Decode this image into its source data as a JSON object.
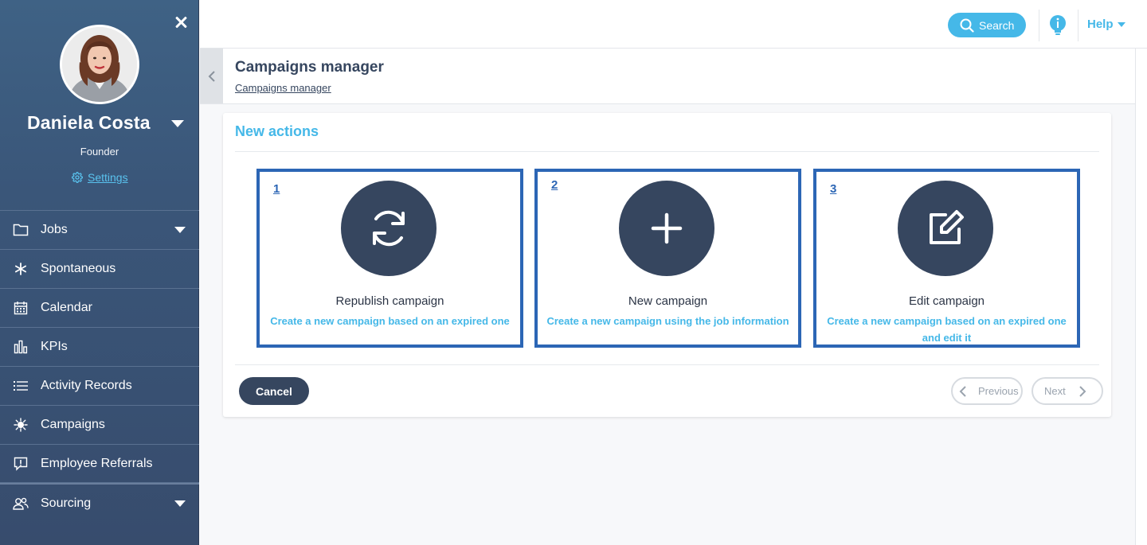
{
  "sidebar": {
    "user": {
      "name": "Daniela Costa",
      "role": "Founder",
      "settings_label": "Settings"
    },
    "items": [
      {
        "label": "Jobs",
        "icon": "folder-icon",
        "has_submenu": true
      },
      {
        "label": "Spontaneous",
        "icon": "asterisk-icon",
        "has_submenu": false
      },
      {
        "label": "Calendar",
        "icon": "calendar-icon",
        "has_submenu": false
      },
      {
        "label": "KPIs",
        "icon": "bar-chart-icon",
        "has_submenu": false
      },
      {
        "label": "Activity Records",
        "icon": "list-icon",
        "has_submenu": false
      },
      {
        "label": "Campaigns",
        "icon": "virus-icon",
        "has_submenu": false
      },
      {
        "label": "Employee Referrals",
        "icon": "feedback-icon",
        "has_submenu": false
      },
      {
        "label": "Sourcing",
        "icon": "users-icon",
        "has_submenu": true
      }
    ]
  },
  "topbar": {
    "search_label": "Search",
    "help_label": "Help"
  },
  "header": {
    "title": "Campaigns manager",
    "breadcrumb": "Campaigns manager"
  },
  "card": {
    "title": "New actions",
    "actions": [
      {
        "number": "1",
        "icon": "refresh-icon",
        "title": "Republish campaign",
        "description": "Create a new campaign based on an expired one"
      },
      {
        "number": "2",
        "icon": "plus-icon",
        "title": "New campaign",
        "description": "Create a new campaign using the job information"
      },
      {
        "number": "3",
        "icon": "edit-icon",
        "title": "Edit campaign",
        "description": "Create a new campaign based on an expired one and edit it"
      }
    ],
    "cancel_label": "Cancel",
    "previous_label": "Previous",
    "next_label": "Next"
  },
  "colors": {
    "accent": "#45b8e8",
    "sidebar": "#3a5679",
    "dark": "#36465f",
    "highlight_border": "#2c66b5"
  }
}
